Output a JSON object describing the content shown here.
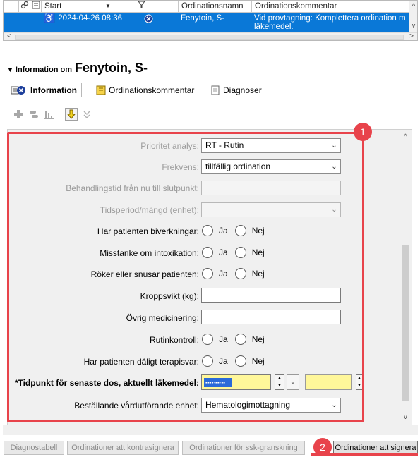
{
  "grid": {
    "columns": [
      "Start",
      "Ordinationsnamn",
      "Ordinationskommentar"
    ],
    "row": {
      "start": "2024-04-26 08:36",
      "name": "Fenytoin, S-",
      "comment_line1": "Vid provtagning: Komplettera ordination m",
      "comment_line2": "läkemedel."
    }
  },
  "info": {
    "prefix": "Information om",
    "subject": "Fenytoin, S-"
  },
  "tabs": [
    {
      "label": "Information",
      "active": true
    },
    {
      "label": "Ordinationskommentar",
      "active": false
    },
    {
      "label": "Diagnoser",
      "active": false
    }
  ],
  "form": {
    "prioritet_label": "Prioritet analys:",
    "prioritet_value": "RT - Rutin",
    "frekvens_label": "Frekvens:",
    "frekvens_value": "tillfällig ordination",
    "behandlingstid_label": "Behandlingstid från nu till slutpunkt:",
    "tidsperiod_label": "Tidsperiod/mängd (enhet):",
    "biverkningar_label": "Har patienten biverkningar:",
    "intoxikation_label": "Misstanke om intoxikation:",
    "roker_label": "Röker eller snusar patienten:",
    "kroppsvikt_label": "Kroppsvikt (kg):",
    "ovrig_label": "Övrig medicinering:",
    "rutinkontroll_label": "Rutinkontroll:",
    "terapisvar_label": "Har patienten dåligt terapisvar:",
    "tidpunkt_label": "*Tidpunkt för senaste dos, aktuellt läkemedel:",
    "bestallande_label": "Beställande vårdutförande enhet:",
    "bestallande_value": "Hematologimottagning",
    "ja": "Ja",
    "nej": "Nej"
  },
  "badges": {
    "one": "1",
    "two": "2"
  },
  "buttons": {
    "diagnostabell": "Diagnostabell",
    "kontrasignera": "Ordinationer att kontrasignera",
    "ssk": "Ordinationer för ssk-granskning",
    "signera": "Ordinationer att signera"
  },
  "colors": {
    "selection": "#0a78d7",
    "highlight": "#e8434b",
    "required_field": "#fff79a"
  }
}
